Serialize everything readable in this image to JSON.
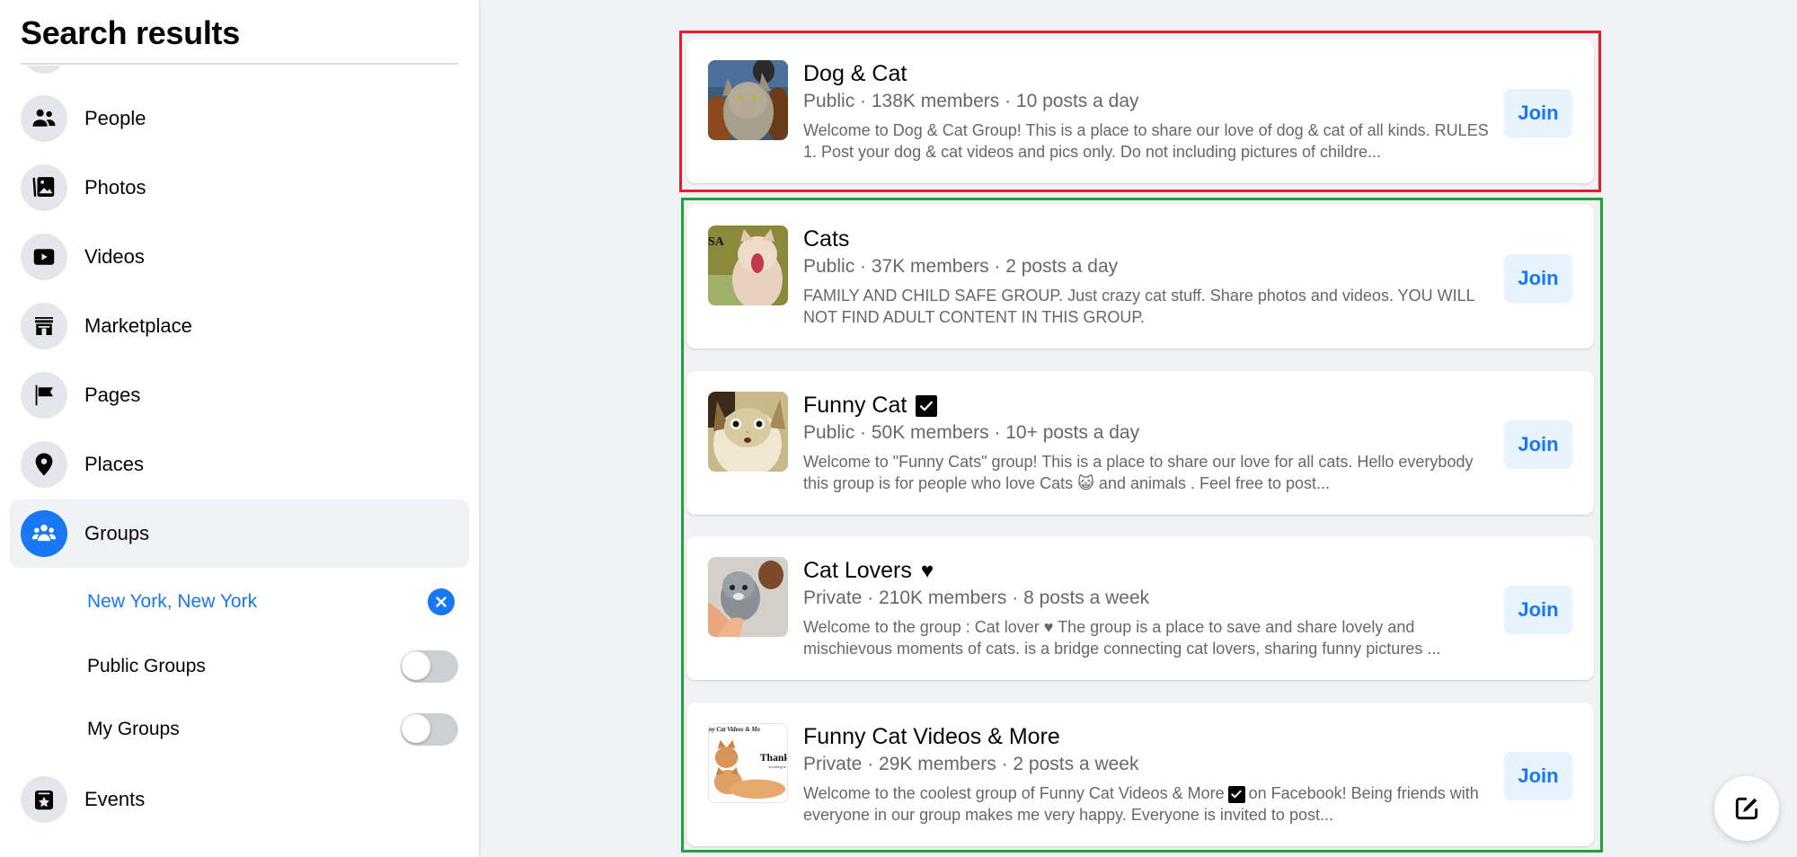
{
  "sidebar": {
    "title": "Search results",
    "items": [
      {
        "label": "People",
        "icon": "people-icon"
      },
      {
        "label": "Photos",
        "icon": "photos-icon"
      },
      {
        "label": "Videos",
        "icon": "video-play-icon"
      },
      {
        "label": "Marketplace",
        "icon": "marketplace-store-icon"
      },
      {
        "label": "Pages",
        "icon": "flag-icon"
      },
      {
        "label": "Places",
        "icon": "location-pin-icon"
      },
      {
        "label": "Groups",
        "icon": "groups-icon",
        "active": true
      },
      {
        "label": "Events",
        "icon": "event-star-icon"
      }
    ],
    "group_filters": {
      "location": {
        "label": "New York, New York",
        "clear_icon": "close-icon"
      },
      "public_groups": {
        "label": "Public Groups",
        "on": false
      },
      "my_groups": {
        "label": "My Groups",
        "on": false
      }
    }
  },
  "results": [
    {
      "name": "Dog & Cat",
      "badge": null,
      "meta": "Public · 138K members · 10 posts a day",
      "desc": "Welcome to Dog & Cat Group! This is a place to share our love of dog & cat of all kinds. RULES 1. Post your dog & cat videos and pics only. Do not including pictures of childre...",
      "join_label": "Join",
      "highlight": "red"
    },
    {
      "name": "Cats",
      "badge": null,
      "meta": "Public · 37K members · 2 posts a day",
      "desc": "FAMILY AND CHILD SAFE GROUP. Just crazy cat stuff. Share photos and videos. YOU WILL NOT FIND ADULT CONTENT IN THIS GROUP.",
      "join_label": "Join",
      "highlight": "green"
    },
    {
      "name": "Funny Cat",
      "badge": "checkbox",
      "meta": "Public · 50K members · 10+ posts a day",
      "desc": "Welcome to \"Funny Cats\" group! This is a place to share our love for all cats. Hello everybody this group is for people who love Cats 😺 and animals . Feel free to post...",
      "join_label": "Join",
      "highlight": "green"
    },
    {
      "name": "Cat Lovers",
      "badge": "heart",
      "meta": "Private · 210K members · 8 posts a week",
      "desc": "Welcome to the group : Cat lover ♥ The group is a place to save and share lovely and mischievous moments of cats. is a bridge connecting cat lovers, sharing funny pictures ...",
      "join_label": "Join",
      "highlight": "green"
    },
    {
      "name": "Funny Cat Videos & More",
      "badge": null,
      "meta": "Private · 29K members · 2 posts a week",
      "desc_before": "Welcome to the coolest group of Funny Cat Videos & More",
      "desc_after": "on Facebook! Being friends with everyone in our group makes me very happy. Everyone is invited to post...",
      "join_label": "Join",
      "highlight": "green"
    }
  ],
  "thumbnail_text": {
    "cats_partial": "SA",
    "funny_videos_top": "ny Cat Videos & Mo",
    "funny_videos_mid": "Thank",
    "funny_videos_small": "for being in"
  },
  "fab": {
    "icon": "compose-edit-icon"
  },
  "colors": {
    "accent": "#1877f2",
    "join_bg": "#e7f3ff",
    "highlight_red": "#e41e2b",
    "highlight_green": "#22a33a",
    "page_bg": "#f0f2f5"
  }
}
